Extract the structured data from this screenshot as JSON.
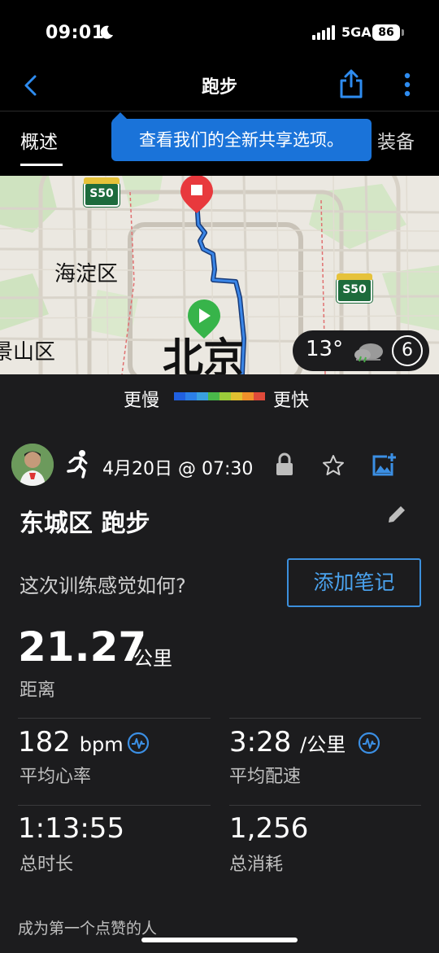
{
  "status_bar": {
    "time": "09:01",
    "network": "5GA",
    "battery": "86"
  },
  "nav": {
    "title": "跑步"
  },
  "tabs": [
    {
      "label": "概述",
      "active": true
    },
    {
      "label": "装备",
      "active": false
    }
  ],
  "tooltip": {
    "text": "查看我们的全新共享选项。"
  },
  "map": {
    "labels": {
      "haidian": "海淀区",
      "jingshan": "景山区",
      "beijing": "北京",
      "road_1": "S50",
      "road_2": "S50"
    },
    "weather": {
      "temp": "13°",
      "wind": "6"
    }
  },
  "speed_legend": {
    "slow": "更慢",
    "fast": "更快",
    "colors": [
      "#2060e0",
      "#2b7fe8",
      "#39a0e0",
      "#49b84a",
      "#9bcb3a",
      "#e0c030",
      "#f0902a",
      "#e04a3a"
    ]
  },
  "activity": {
    "date": "4月20日 @ 07:30",
    "name": "东城区 跑步",
    "feel_question": "这次训练感觉如何?",
    "note_button": "添加笔记",
    "distance": {
      "value": "21.27",
      "unit": "公里",
      "label": "距离"
    },
    "stats": {
      "heart_rate": {
        "value": "182",
        "unit": "bpm",
        "label": "平均心率"
      },
      "pace": {
        "value": "3:28",
        "unit": "/公里",
        "label": "平均配速"
      },
      "duration": {
        "value": "1:13:55",
        "label": "总时长"
      },
      "calories": {
        "value": "1,256",
        "label": "总消耗"
      }
    },
    "kudos": "成为第一个点赞的人"
  },
  "colors": {
    "accent": "#1a73d9",
    "link": "#4aa3ef",
    "background": "#1c1c1e"
  }
}
